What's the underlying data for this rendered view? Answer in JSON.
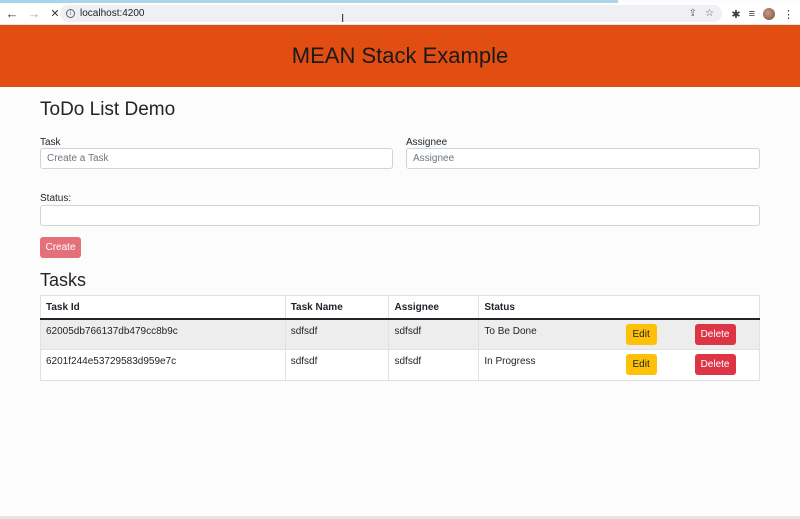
{
  "browser": {
    "url": "localhost:4200",
    "back_glyph": "←",
    "forward_glyph": "→",
    "stop_glyph": "✕",
    "info_glyph": "i",
    "share_glyph": "⇪",
    "star_glyph": "☆",
    "extensions_glyph": "✱",
    "playlist_glyph": "≡",
    "menu_glyph": "⋮",
    "cursor_glyph": "I"
  },
  "header": {
    "title": "MEAN Stack Example"
  },
  "form": {
    "title": "ToDo List Demo",
    "task_label": "Task",
    "task_placeholder": "Create a Task",
    "task_value": "",
    "assignee_label": "Assignee",
    "assignee_placeholder": "Assignee",
    "assignee_value": "",
    "status_label": "Status:",
    "status_value": "",
    "create_label": "Create"
  },
  "tasks": {
    "title": "Tasks",
    "columns": [
      "Task Id",
      "Task Name",
      "Assignee",
      "Status"
    ],
    "rows": [
      {
        "id": "62005db766137db479cc8b9c",
        "name": "sdfsdf",
        "assignee": "sdfsdf",
        "status": "To Be Done",
        "edit": "Edit",
        "delete": "Delete"
      },
      {
        "id": "6201f244e53729583d959e7c",
        "name": "sdfsdf",
        "assignee": "sdfsdf",
        "status": "In Progress",
        "edit": "Edit",
        "delete": "Delete"
      }
    ]
  },
  "colors": {
    "header_bg": "#e24e12",
    "create_btn": "#e4707a",
    "edit_btn": "#ffc107",
    "delete_btn": "#dc3545"
  },
  "icons": {
    "back": "back-arrow-icon",
    "forward": "forward-arrow-icon",
    "stop": "stop-loading-icon",
    "info": "site-info-icon",
    "share": "share-icon",
    "star": "bookmark-star-icon",
    "extensions": "extensions-puzzle-icon",
    "playlist": "media-playlist-icon",
    "menu": "kebab-menu-icon"
  }
}
